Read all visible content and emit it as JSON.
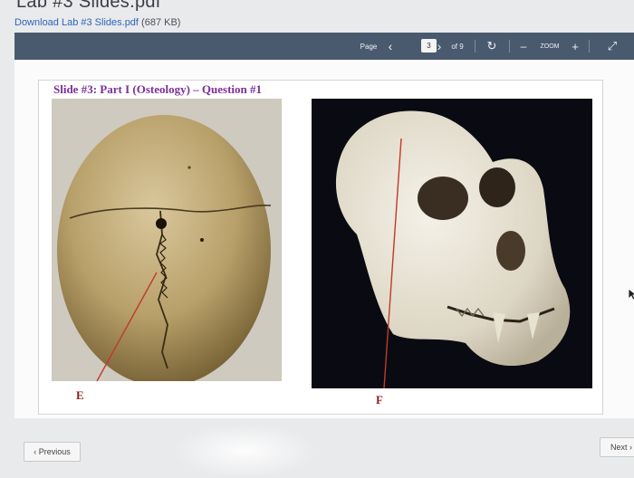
{
  "header": {
    "title": "Lab #3 Slides.pdf"
  },
  "download": {
    "link_text": "Download Lab #3 Slides.pdf",
    "size": "(687 KB)"
  },
  "toolbar": {
    "page_label": "Page",
    "page_value": "3",
    "of_label": "of 9",
    "zoom_label": "ZOOM",
    "minus": "–",
    "plus": "+",
    "prev_page": "‹",
    "next_page": "›",
    "rotate": "↻",
    "fullscreen": "⤢"
  },
  "slide": {
    "title": "Slide #3: Part I (Osteology) – Question #1",
    "label_e": "E",
    "label_f": "F"
  },
  "nav": {
    "previous": "‹ Previous",
    "next": "Next ›"
  },
  "colors": {
    "toolbar": "#4a5a6e",
    "title": "#7a2f9a",
    "pointer_line": "#c0392b"
  }
}
